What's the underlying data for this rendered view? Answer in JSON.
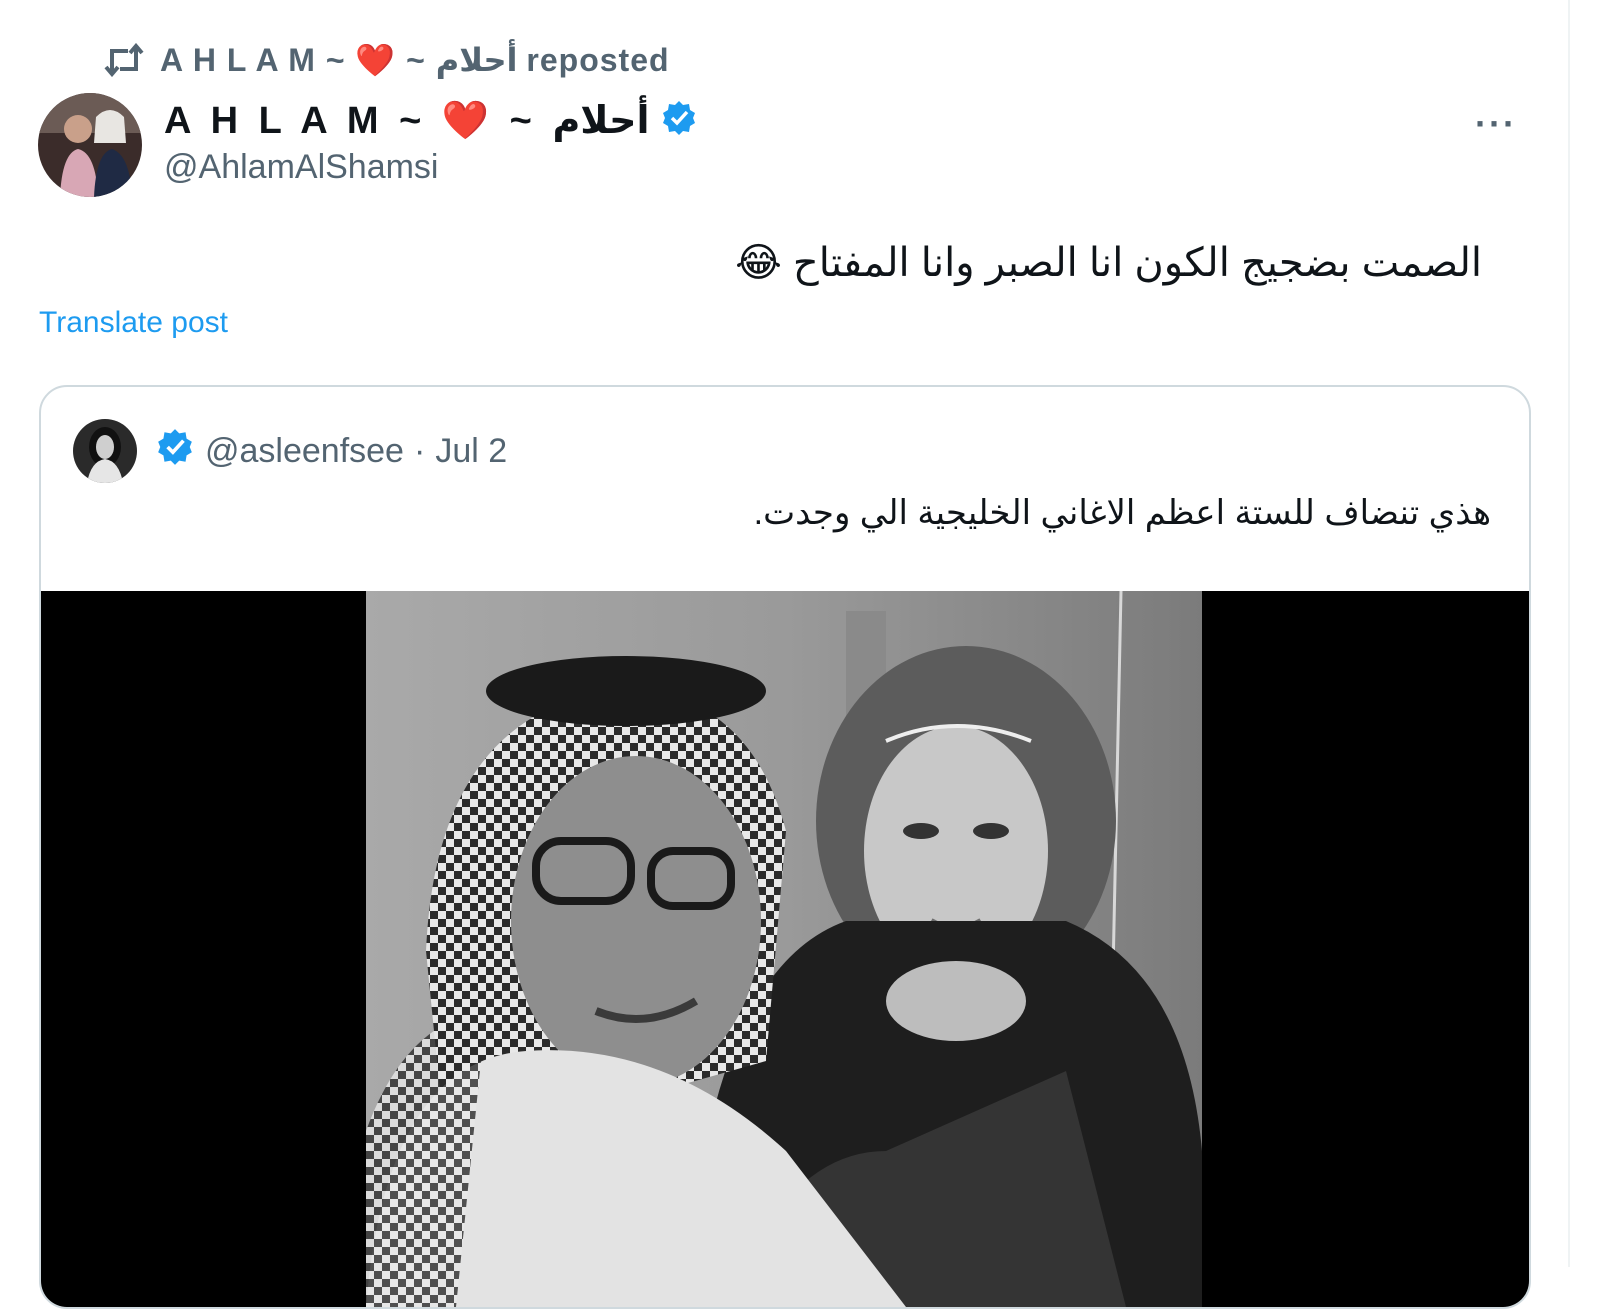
{
  "repost": {
    "text": "A H L A M ~ ❤️ ~ أحلام reposted"
  },
  "author": {
    "display_name": "A H L A M ~ ❤️ ~ أحلام",
    "handle": "@AhlamAlShamsi",
    "more": "···"
  },
  "tweet": {
    "text": "الصمت بضجيج الكون انا الصبر وانا المفتاح 😂",
    "translate_label": "Translate post"
  },
  "quote": {
    "handle": "@asleenfsee",
    "separator": "·",
    "date": "Jul 2",
    "text": "هذي تنضاف للستة اعظم الاغاني الخليجية الي وجدت."
  },
  "colors": {
    "accent": "#1d9bf0",
    "muted": "#536471",
    "border": "#cfd9de",
    "heart": "#e0245e"
  }
}
